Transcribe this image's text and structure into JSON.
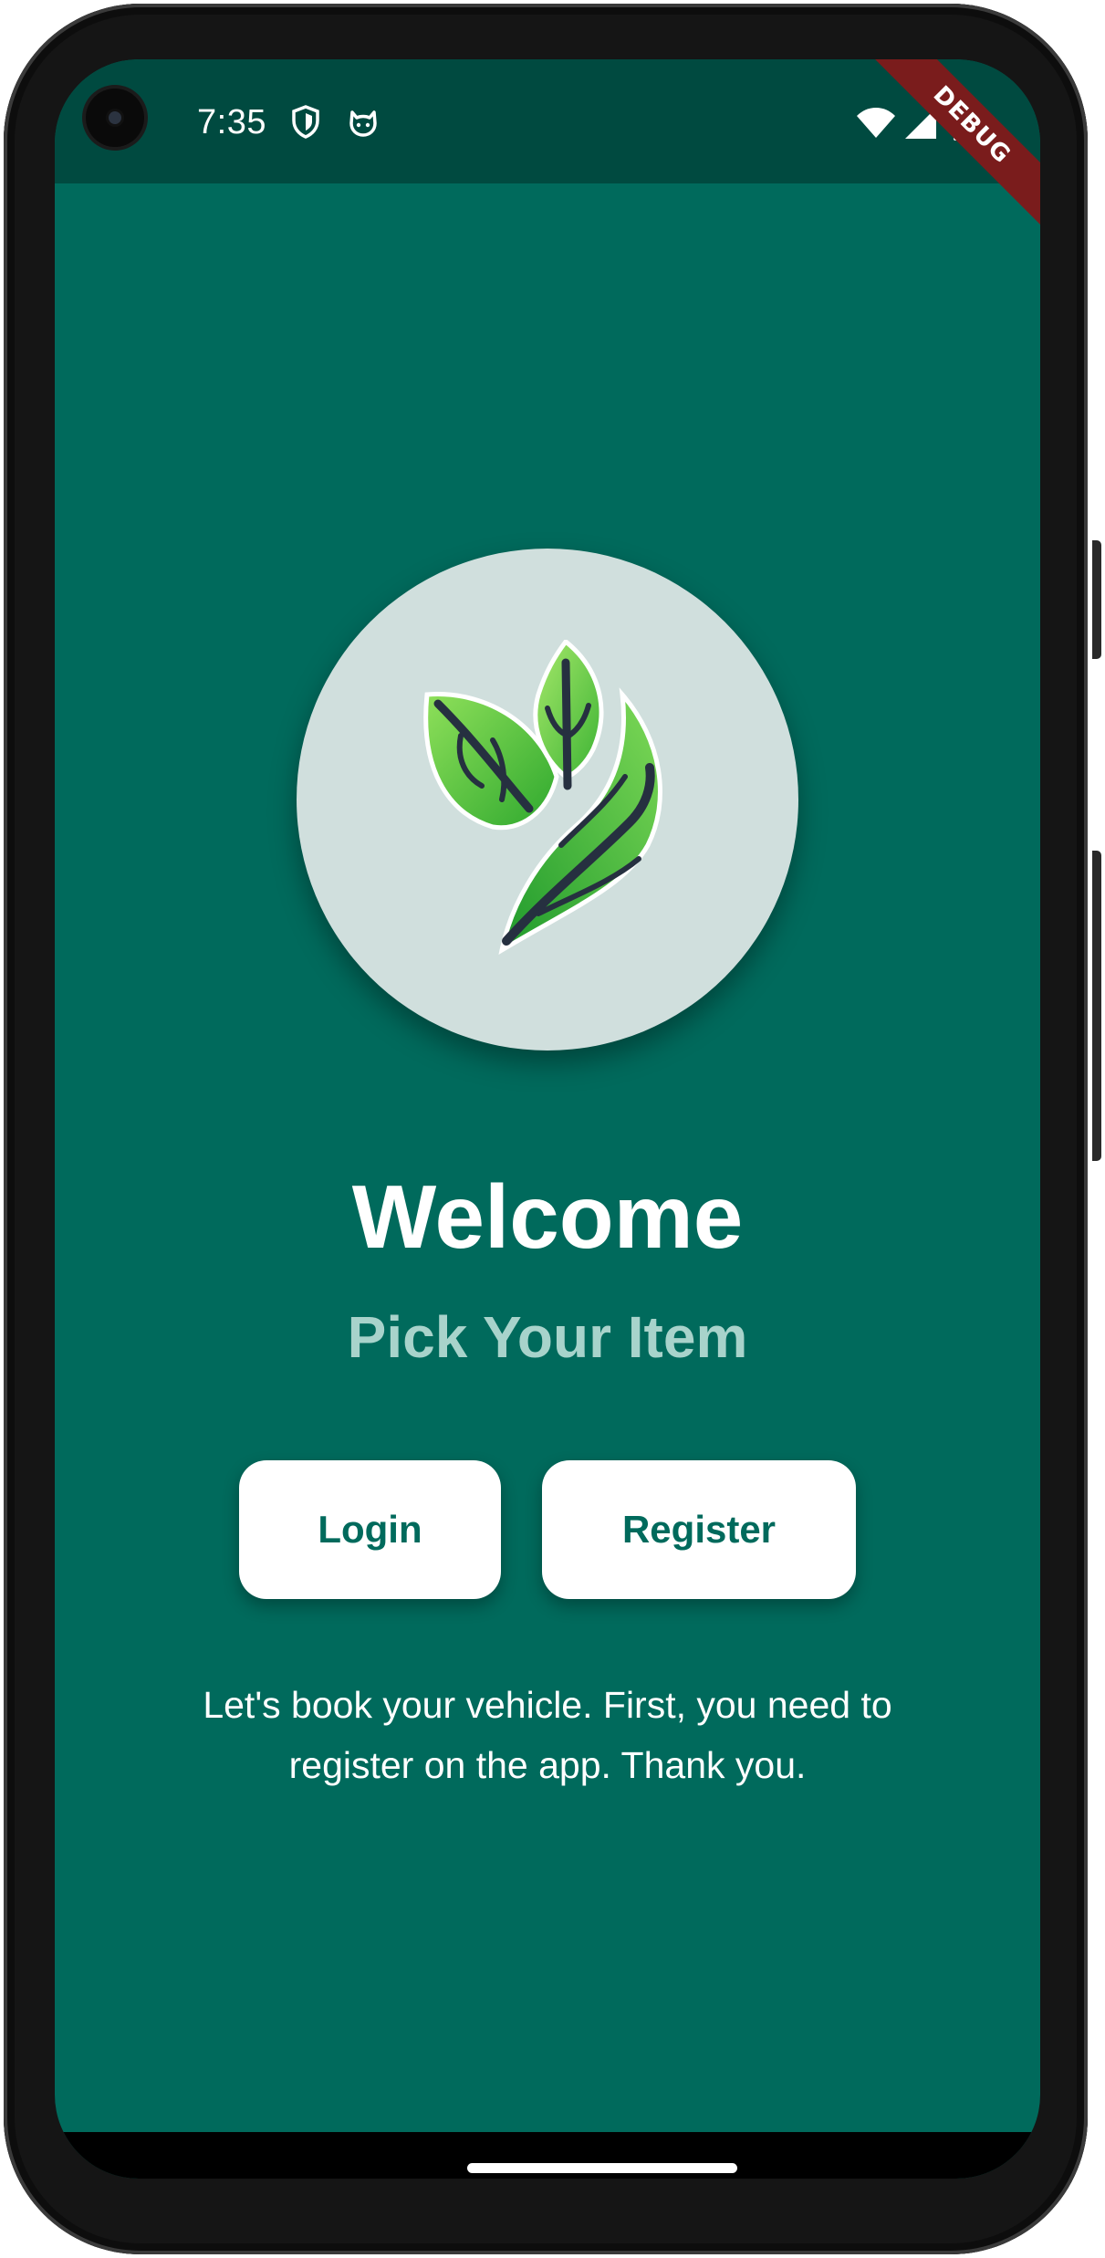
{
  "status_bar": {
    "time": "7:35",
    "left_icons": [
      "shield-icon",
      "cat-face-icon"
    ],
    "right_icons": [
      "wifi-icon",
      "cellular-signal-icon",
      "battery-icon"
    ]
  },
  "debug_banner": "DEBUG",
  "logo": {
    "icon": "leaves-logo-icon"
  },
  "main": {
    "title": "Welcome",
    "subtitle": "Pick Your Item",
    "login_label": "Login",
    "register_label": "Register",
    "description": "Let's book your vehicle. First, you need to register on the app. Thank you."
  },
  "colors": {
    "background": "#006a5c",
    "status_bar": "#004a40",
    "logo_circle": "#d0dfdd",
    "subtitle": "#a8d3cb",
    "button_bg": "#ffffff",
    "button_text": "#006a5c",
    "debug_banner": "#7a1c1c"
  }
}
